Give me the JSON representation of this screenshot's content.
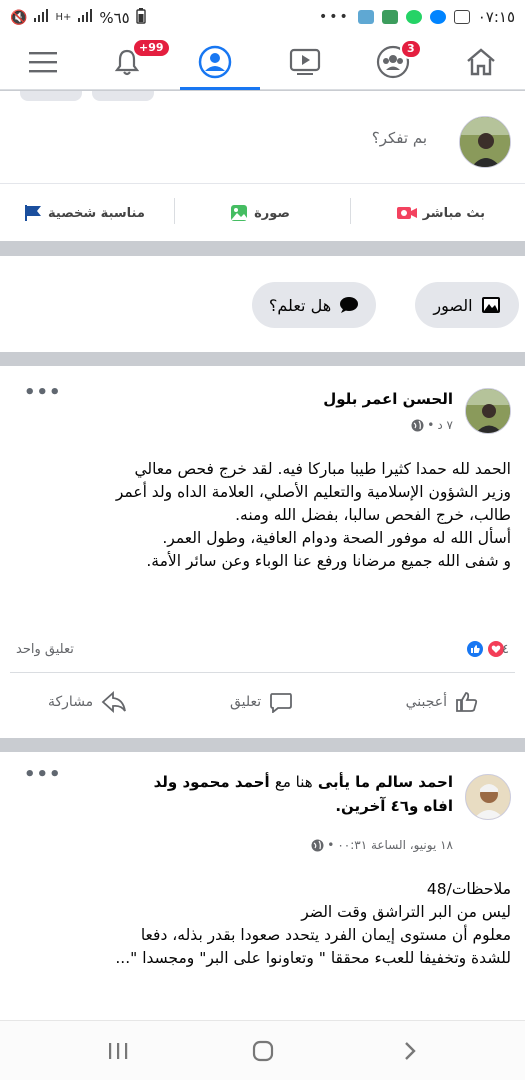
{
  "status_bar": {
    "time": "٠٧:١٥",
    "battery": "%٦٥"
  },
  "top_nav": {
    "notifications_badge": "+99",
    "groups_badge": "3"
  },
  "composer": {
    "placeholder": "بم تفكر؟",
    "live_label": "بث مباشر",
    "photo_label": "صورة",
    "life_event_label": "مناسبة شخصية"
  },
  "chips": {
    "photos_label": "الصور",
    "did_you_know_label": "هل تعلم؟"
  },
  "post1": {
    "author": "الحسن اعمر بلول",
    "time": "٧ د",
    "lines": [
      "الحمد لله حمدا كثيرا طيبا مباركا فيه. لقد خرج فحص معالي",
      "وزير الشؤون الإسلامية والتعليم الأصلي، العلامة الداه ولد أعمر",
      "طالب، خرج الفحص سالبا، بفضل الله ومنه.",
      "أسأل الله له موفور الصحة ودوام العافية، وطول العمر.",
      "و شفى  الله جميع مرضانا ورفع عنا الوباء وعن سائر الأمة."
    ],
    "reactions_count": "٤",
    "comments_count": "تعليق واحد",
    "like_label": "أعجبني",
    "comment_label": "تعليق",
    "share_label": "مشاركة"
  },
  "post2": {
    "author": "احمد سالم ما يأبى",
    "with_text": "هنا مع",
    "tagged": "أحمد محمود ولد",
    "tagged_line2": "افاه",
    "and_others": "و٤٦ آخرين.",
    "time": "١٨ يونيو، الساعة ٠٠:٣١",
    "lines": [
      "ملاحظات/48",
      "ليس من البر التراشق وقت الضر",
      "معلوم أن مستوى إيمان الفرد يتحدد صعودا بقدر بذله، دفعا",
      "للشدة وتخفيفا للعبء محققا \" وتعاونوا على البر\" ومجسدا \"..."
    ]
  },
  "colors": {
    "fb_blue": "#1877f2",
    "badge_red": "#e41e3f",
    "love_red": "#f33e58"
  }
}
